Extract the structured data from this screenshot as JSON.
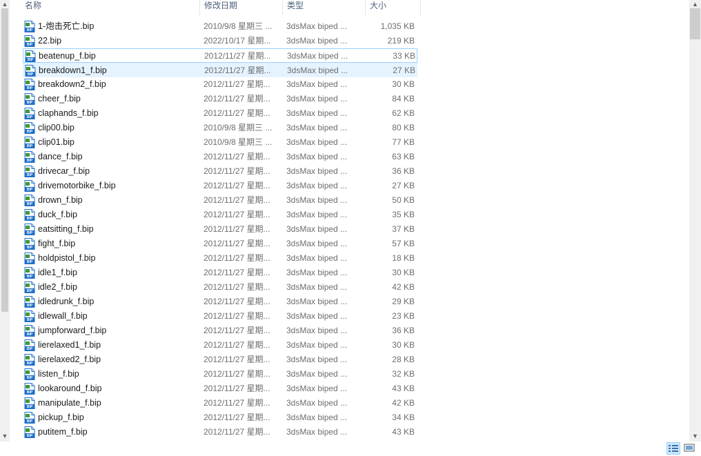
{
  "columns": {
    "name": "名称",
    "date": "修改日期",
    "type": "类型",
    "size": "大小"
  },
  "icon_label": "BIP",
  "files": [
    {
      "name": "1-炮击死亡.bip",
      "date": "2010/9/8 星期三 ...",
      "type": "3dsMax biped ...",
      "size": "1,035 KB"
    },
    {
      "name": "22.bip",
      "date": "2022/10/17 星期...",
      "type": "3dsMax biped ...",
      "size": "219 KB"
    },
    {
      "name": "beatenup_f.bip",
      "date": "2012/11/27 星期...",
      "type": "3dsMax biped ...",
      "size": "33 KB",
      "state": "hover"
    },
    {
      "name": "breakdown1_f.bip",
      "date": "2012/11/27 星期...",
      "type": "3dsMax biped ...",
      "size": "27 KB",
      "state": "selected"
    },
    {
      "name": "breakdown2_f.bip",
      "date": "2012/11/27 星期...",
      "type": "3dsMax biped ...",
      "size": "30 KB"
    },
    {
      "name": "cheer_f.bip",
      "date": "2012/11/27 星期...",
      "type": "3dsMax biped ...",
      "size": "84 KB"
    },
    {
      "name": "claphands_f.bip",
      "date": "2012/11/27 星期...",
      "type": "3dsMax biped ...",
      "size": "62 KB"
    },
    {
      "name": "clip00.bip",
      "date": "2010/9/8 星期三 ...",
      "type": "3dsMax biped ...",
      "size": "80 KB"
    },
    {
      "name": "clip01.bip",
      "date": "2010/9/8 星期三 ...",
      "type": "3dsMax biped ...",
      "size": "77 KB"
    },
    {
      "name": "dance_f.bip",
      "date": "2012/11/27 星期...",
      "type": "3dsMax biped ...",
      "size": "63 KB"
    },
    {
      "name": "drivecar_f.bip",
      "date": "2012/11/27 星期...",
      "type": "3dsMax biped ...",
      "size": "36 KB"
    },
    {
      "name": "drivemotorbike_f.bip",
      "date": "2012/11/27 星期...",
      "type": "3dsMax biped ...",
      "size": "27 KB"
    },
    {
      "name": "drown_f.bip",
      "date": "2012/11/27 星期...",
      "type": "3dsMax biped ...",
      "size": "50 KB"
    },
    {
      "name": "duck_f.bip",
      "date": "2012/11/27 星期...",
      "type": "3dsMax biped ...",
      "size": "35 KB"
    },
    {
      "name": "eatsitting_f.bip",
      "date": "2012/11/27 星期...",
      "type": "3dsMax biped ...",
      "size": "37 KB"
    },
    {
      "name": "fight_f.bip",
      "date": "2012/11/27 星期...",
      "type": "3dsMax biped ...",
      "size": "57 KB"
    },
    {
      "name": "holdpistol_f.bip",
      "date": "2012/11/27 星期...",
      "type": "3dsMax biped ...",
      "size": "18 KB"
    },
    {
      "name": "idle1_f.bip",
      "date": "2012/11/27 星期...",
      "type": "3dsMax biped ...",
      "size": "30 KB"
    },
    {
      "name": "idle2_f.bip",
      "date": "2012/11/27 星期...",
      "type": "3dsMax biped ...",
      "size": "42 KB"
    },
    {
      "name": "idledrunk_f.bip",
      "date": "2012/11/27 星期...",
      "type": "3dsMax biped ...",
      "size": "29 KB"
    },
    {
      "name": "idlewall_f.bip",
      "date": "2012/11/27 星期...",
      "type": "3dsMax biped ...",
      "size": "23 KB"
    },
    {
      "name": "jumpforward_f.bip",
      "date": "2012/11/27 星期...",
      "type": "3dsMax biped ...",
      "size": "36 KB"
    },
    {
      "name": "lierelaxed1_f.bip",
      "date": "2012/11/27 星期...",
      "type": "3dsMax biped ...",
      "size": "30 KB"
    },
    {
      "name": "lierelaxed2_f.bip",
      "date": "2012/11/27 星期...",
      "type": "3dsMax biped ...",
      "size": "28 KB"
    },
    {
      "name": "listen_f.bip",
      "date": "2012/11/27 星期...",
      "type": "3dsMax biped ...",
      "size": "32 KB"
    },
    {
      "name": "lookaround_f.bip",
      "date": "2012/11/27 星期...",
      "type": "3dsMax biped ...",
      "size": "43 KB"
    },
    {
      "name": "manipulate_f.bip",
      "date": "2012/11/27 星期...",
      "type": "3dsMax biped ...",
      "size": "42 KB"
    },
    {
      "name": "pickup_f.bip",
      "date": "2012/11/27 星期...",
      "type": "3dsMax biped ...",
      "size": "34 KB"
    },
    {
      "name": "putitem_f.bip",
      "date": "2012/11/27 星期...",
      "type": "3dsMax biped ...",
      "size": "43 KB"
    }
  ],
  "colors": {
    "selected_bg": "#e5f3ff",
    "hover_border": "#99d1ff",
    "icon_blue": "#1e6fc7",
    "icon_accent": "#3a9a3a"
  },
  "view_modes": [
    "details-view",
    "large-icons-view"
  ],
  "active_view": "details-view"
}
